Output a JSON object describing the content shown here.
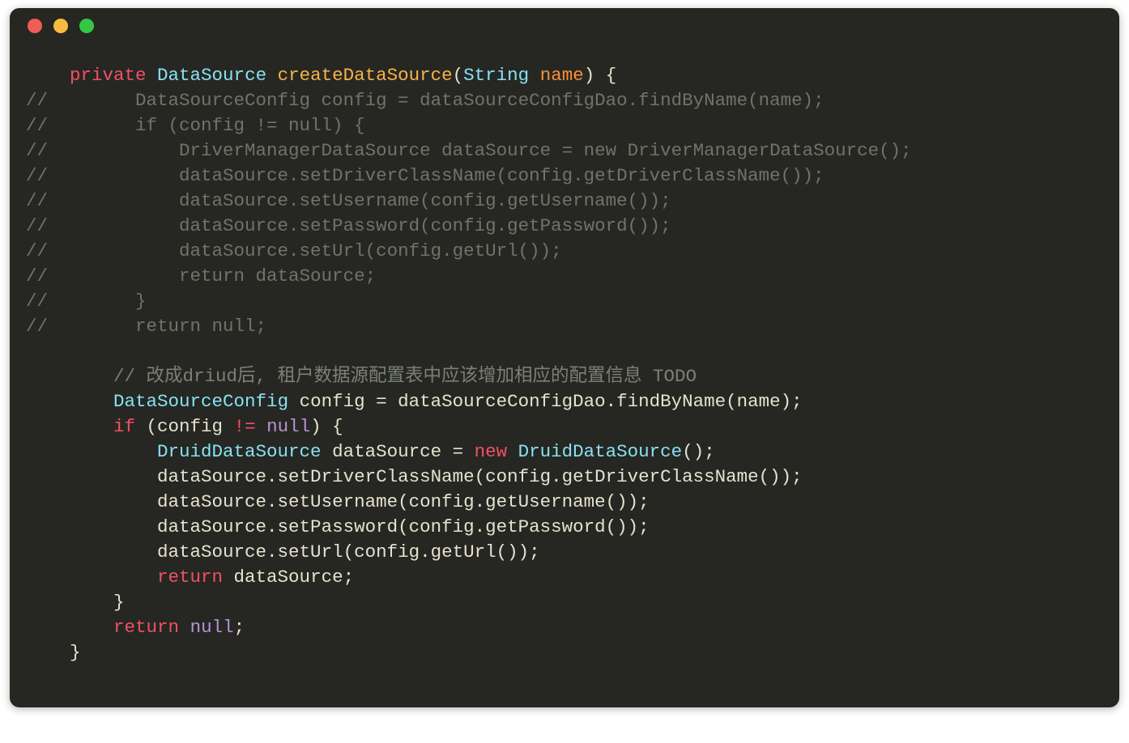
{
  "window": {
    "traffic": {
      "close": "#f05d54",
      "min": "#f6bc3d",
      "max": "#35c646"
    }
  },
  "code": {
    "l1_private": "private",
    "l1_type1": "DataSource",
    "l1_method": "createDataSource",
    "l1_paren1": "(",
    "l1_type2": "String",
    "l1_param": "name",
    "l1_paren2": ")",
    "l1_brace": " {",
    "c1": "//        DataSourceConfig config = dataSourceConfigDao.findByName(name);",
    "c2": "//        if (config != null) {",
    "c3": "//            DriverManagerDataSource dataSource = new DriverManagerDataSource();",
    "c4": "//            dataSource.setDriverClassName(config.getDriverClassName());",
    "c5": "//            dataSource.setUsername(config.getUsername());",
    "c6": "//            dataSource.setPassword(config.getPassword());",
    "c7": "//            dataSource.setUrl(config.getUrl());",
    "c8": "//            return dataSource;",
    "c9": "//        }",
    "c10": "//        return null;",
    "cc": "// 改成driud后, 租户数据源配置表中应该增加相应的配置信息 TODO",
    "a1_type1": "DataSourceConfig",
    "a1_rest": " config = dataSourceConfigDao.findByName(name);",
    "a2_if": "if",
    "a2_open": " (config ",
    "a2_neq": "!=",
    "a2_sp": " ",
    "a2_null": "null",
    "a2_close": ") {",
    "a3_type": "DruidDataSource",
    "a3_mid": " dataSource = ",
    "a3_new": "new",
    "a3_sp": " ",
    "a3_type2": "DruidDataSource",
    "a3_end": "();",
    "a4": "dataSource.setDriverClassName(config.getDriverClassName());",
    "a5": "dataSource.setUsername(config.getUsername());",
    "a6": "dataSource.setPassword(config.getPassword());",
    "a7": "dataSource.setUrl(config.getUrl());",
    "a8_ret": "return",
    "a8_rest": " dataSource;",
    "a9": "}",
    "a10_ret": "return",
    "a10_sp": " ",
    "a10_null": "null",
    "a10_semi": ";",
    "a11": "}"
  }
}
